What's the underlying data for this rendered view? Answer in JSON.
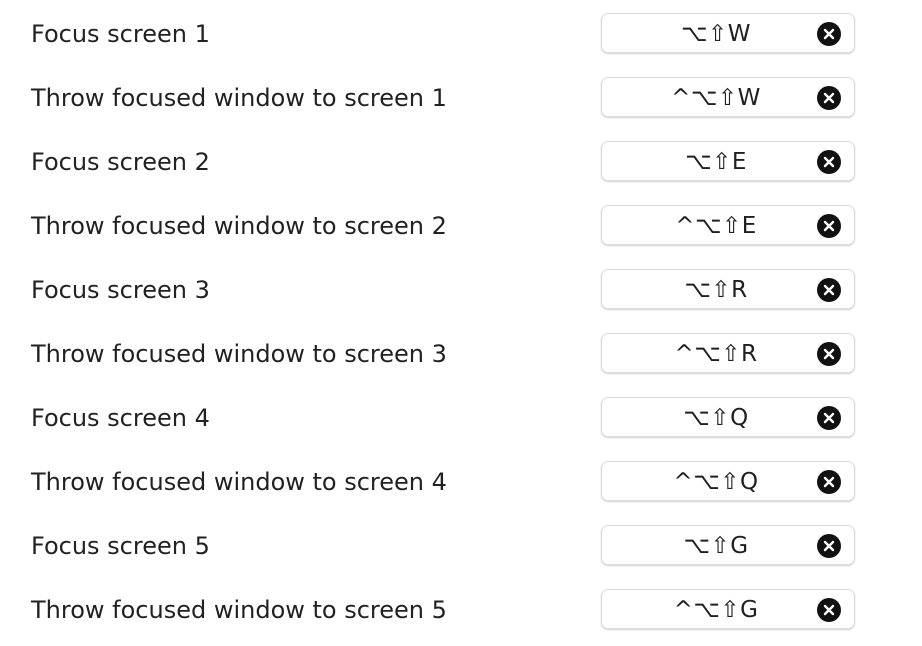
{
  "shortcuts": [
    {
      "label": "Focus screen 1",
      "keys": "⌥⇧W",
      "clear_icon": "x-circle-fill-icon"
    },
    {
      "label": "Throw focused window to screen 1",
      "keys": "^⌥⇧W",
      "clear_icon": "x-circle-fill-icon"
    },
    {
      "label": "Focus screen 2",
      "keys": "⌥⇧E",
      "clear_icon": "x-circle-fill-icon"
    },
    {
      "label": "Throw focused window to screen 2",
      "keys": "^⌥⇧E",
      "clear_icon": "x-circle-fill-icon"
    },
    {
      "label": "Focus screen 3",
      "keys": "⌥⇧R",
      "clear_icon": "x-circle-fill-icon"
    },
    {
      "label": "Throw focused window to screen 3",
      "keys": "^⌥⇧R",
      "clear_icon": "x-circle-fill-icon"
    },
    {
      "label": "Focus screen 4",
      "keys": "⌥⇧Q",
      "clear_icon": "x-circle-fill-icon"
    },
    {
      "label": "Throw focused window to screen 4",
      "keys": "^⌥⇧Q",
      "clear_icon": "x-circle-fill-icon"
    },
    {
      "label": "Focus screen 5",
      "keys": "⌥⇧G",
      "clear_icon": "x-circle-fill-icon"
    },
    {
      "label": "Throw focused window to screen 5",
      "keys": "^⌥⇧G",
      "clear_icon": "x-circle-fill-icon"
    }
  ]
}
